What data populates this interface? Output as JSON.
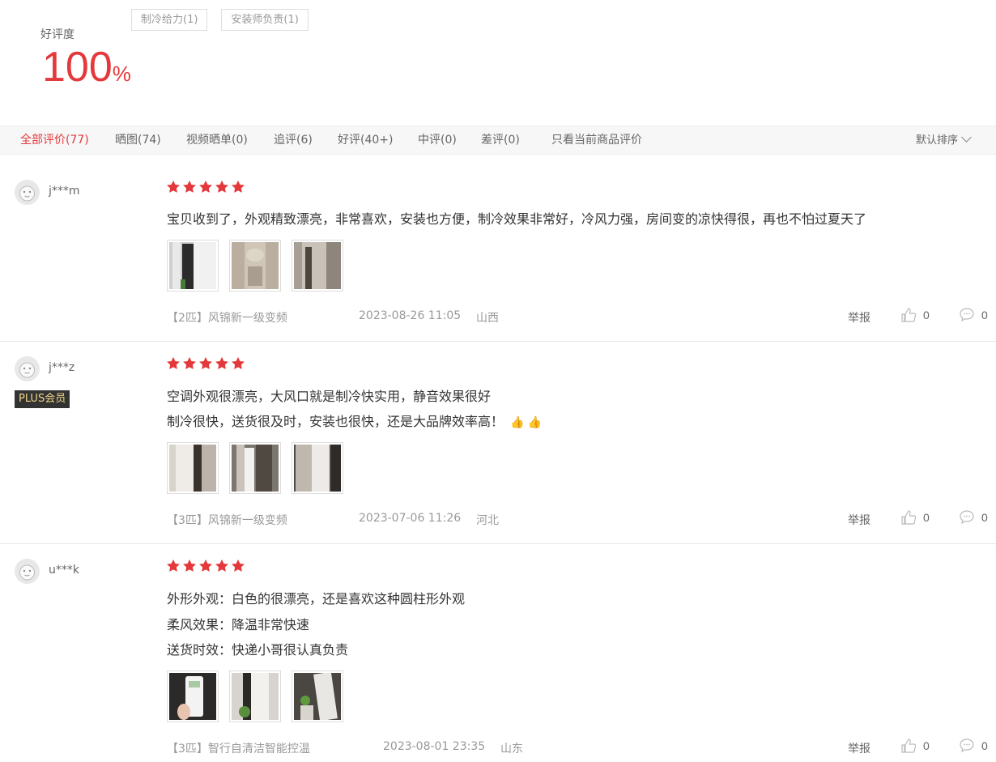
{
  "summary": {
    "rate_label": "好评度",
    "rate_value": "100",
    "rate_unit": "%",
    "tags": [
      "制冷给力(1)",
      "安装师负责(1)"
    ]
  },
  "filters": {
    "all": "全部评价(77)",
    "photos": "晒图(74)",
    "video": "视频晒单(0)",
    "followup": "追评(6)",
    "good": "好评(40+)",
    "medium": "中评(0)",
    "bad": "差评(0)",
    "current": "只看当前商品评价",
    "sort": "默认排序"
  },
  "colors": {
    "accent": "#e4393c",
    "plus_bg": "#333333",
    "plus_text": "#f3d589"
  },
  "reviews": [
    {
      "user": "j***m",
      "rating": 5,
      "lines": [
        "宝贝收到了，外观精致漂亮，非常喜欢，安装也方便，制冷效果非常好，冷风力强，房间变的凉快得很，再也不怕过夏天了"
      ],
      "spec": "【2匹】风锦新一级变频",
      "date": "2023-08-26 11:05",
      "location": "山西",
      "report": "举报",
      "likes": "0",
      "comments": "0"
    },
    {
      "user": "j***z",
      "badge": "PLUS会员",
      "rating": 5,
      "lines": [
        "空调外观很漂亮，大风口就是制冷快实用，静音效果很好",
        "制冷很快，送货很及时，安装也很快，还是大品牌效率高！"
      ],
      "spec": "【3匹】风锦新一级变频",
      "date": "2023-07-06 11:26",
      "location": "河北",
      "report": "举报",
      "likes": "0",
      "comments": "0"
    },
    {
      "user": "u***k",
      "rating": 5,
      "lines": [
        "外形外观：白色的很漂亮，还是喜欢这种圆柱形外观",
        "柔风效果：降温非常快速",
        "送货时效：快递小哥很认真负责"
      ],
      "spec": "【3匹】智行自清洁智能控温",
      "date": "2023-08-01 23:35",
      "location": "山东",
      "report": "举报",
      "likes": "0",
      "comments": "0"
    }
  ]
}
